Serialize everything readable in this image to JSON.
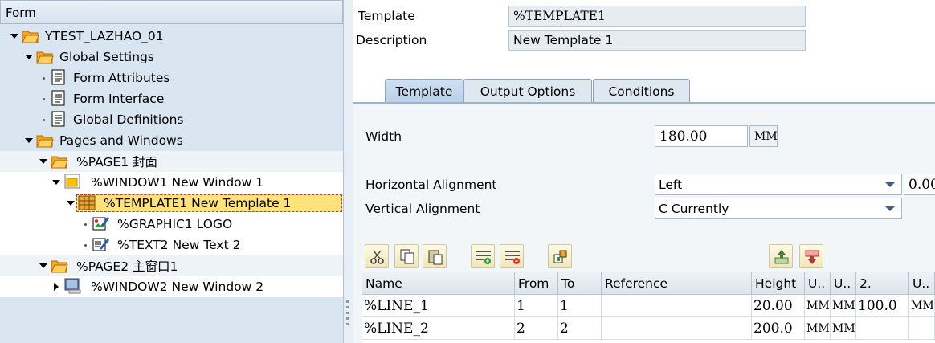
{
  "left_panel": {
    "header": "Form",
    "tree": [
      {
        "label": "YTEST_LAZHAO_01"
      },
      {
        "label": "Global Settings"
      },
      {
        "label": "Form Attributes"
      },
      {
        "label": "Form Interface"
      },
      {
        "label": "Global Definitions"
      },
      {
        "label": "Pages and Windows"
      },
      {
        "label": "%PAGE1 封面"
      },
      {
        "label": "%WINDOW1 New Window 1"
      },
      {
        "label": "%TEMPLATE1 New Template 1"
      },
      {
        "label": "%GRAPHIC1 LOGO"
      },
      {
        "label": "%TEXT2 New Text 2"
      },
      {
        "label": "%PAGE2 主窗口1"
      },
      {
        "label": "%WINDOW2 New Window 2"
      }
    ]
  },
  "header_fields": {
    "template_label": "Template",
    "template_value": "%TEMPLATE1",
    "description_label": "Description",
    "description_value": "New Template 1"
  },
  "tabs": [
    {
      "label": "Template",
      "active": true
    },
    {
      "label": "Output Options",
      "active": false
    },
    {
      "label": "Conditions",
      "active": false
    }
  ],
  "template_tab": {
    "width_label": "Width",
    "width_value": "180.00",
    "width_unit": "MM",
    "h_align_label": "Horizontal Alignment",
    "h_align_value": "Left",
    "h_align_offset": "0.00",
    "v_align_label": "Vertical Alignment",
    "v_align_value": "C Currently"
  },
  "toolbar": {
    "icons": [
      "cut-icon",
      "copy-icon",
      "paste-icon",
      "insert-row-icon",
      "delete-row-icon",
      "detail-icon",
      "move-up-icon",
      "move-down-icon"
    ]
  },
  "table": {
    "columns": [
      "Name",
      "From",
      "To",
      "Reference",
      "Height",
      "U..",
      "U..",
      "2.",
      "U.."
    ],
    "rows": [
      [
        "%LINE_1",
        "1",
        "1",
        "",
        "20.00",
        "MM",
        "MM",
        "100.0",
        "MM"
      ],
      [
        "%LINE_2",
        "2",
        "2",
        "",
        "200.0",
        "MM",
        "MM",
        "",
        ""
      ]
    ]
  },
  "colors": {
    "tree_bg": "#d9e5f1",
    "selection": "#ffe27a",
    "tab_active": "#b9d0e7"
  }
}
